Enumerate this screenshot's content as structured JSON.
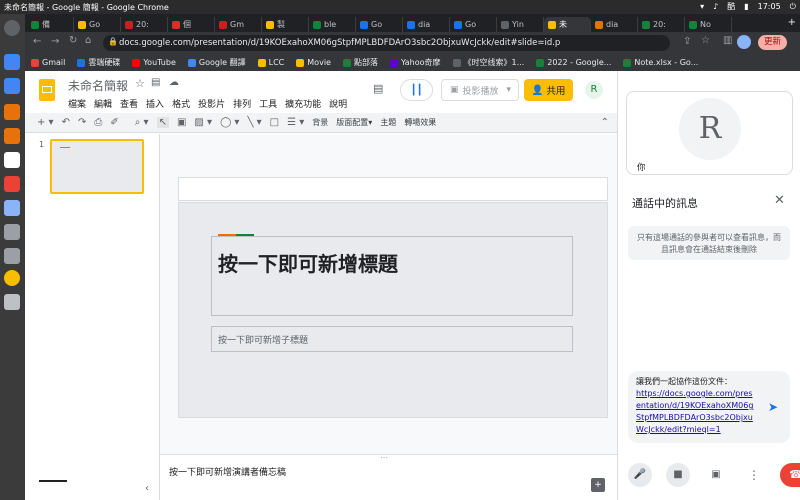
{
  "os": {
    "window_title": "未命名簡報 - Google 簡報 - Google Chrome",
    "clock": "17:05"
  },
  "tabs": [
    {
      "label": "備",
      "color": "#188038"
    },
    {
      "label": "Go",
      "color": "#fbbc04"
    },
    {
      "label": "20:",
      "color": "#c5221f"
    },
    {
      "label": "個",
      "color": "#d93025"
    },
    {
      "label": "Gm",
      "color": "#c5221f"
    },
    {
      "label": "製",
      "color": "#fbbc04"
    },
    {
      "label": "ble",
      "color": "#188038"
    },
    {
      "label": "Go",
      "color": "#1a73e8"
    },
    {
      "label": "dia",
      "color": "#1a73e8"
    },
    {
      "label": "Go",
      "color": "#1a73e8"
    },
    {
      "label": "Yin",
      "color": "#5f6368"
    },
    {
      "label": "未",
      "color": "#fbbc04"
    },
    {
      "label": "dia",
      "color": "#e37400"
    },
    {
      "label": "20:",
      "color": "#188038"
    },
    {
      "label": "No",
      "color": "#188038"
    }
  ],
  "browser": {
    "url": "docs.google.com/presentation/d/19KOExahoXM06gStpfMPLBDFDArO3sbc2ObjxuWcJckk/edit#slide=id.p",
    "update_label": "更新"
  },
  "bookmarks": [
    {
      "label": "Gmail",
      "color": "#ea4335"
    },
    {
      "label": "雲端硬碟",
      "color": "#1a73e8"
    },
    {
      "label": "YouTube",
      "color": "#ff0000"
    },
    {
      "label": "Google 翻譯",
      "color": "#4285f4"
    },
    {
      "label": "LCC",
      "color": "#fbbc04"
    },
    {
      "label": "Movie",
      "color": "#fbbc04"
    },
    {
      "label": "點部落",
      "color": "#188038"
    },
    {
      "label": "Yahoo奇摩",
      "color": "#6001d2"
    },
    {
      "label": "《时空线索》1...",
      "color": "#5f6368"
    },
    {
      "label": "2022 - Google...",
      "color": "#188038"
    },
    {
      "label": "Note.xlsx - Go...",
      "color": "#188038"
    }
  ],
  "doc": {
    "title": "未命名簡報",
    "menus": [
      "檔案",
      "編輯",
      "查看",
      "插入",
      "格式",
      "投影片",
      "排列",
      "工具",
      "擴充功能",
      "說明"
    ],
    "present_label": "投影播放",
    "share_label": "共用",
    "toolbar_labels": {
      "background": "背景",
      "layout": "版面配置",
      "theme": "主題",
      "transition": "轉場效果"
    }
  },
  "slide": {
    "number": "1",
    "title_placeholder": "按一下即可新增標題",
    "subtitle_placeholder": "按一下即可新增子標題",
    "notes_placeholder": "按一下即可新增演講者備忘稿"
  },
  "call": {
    "you_label": "你",
    "panel_title": "通話中的訊息",
    "info": "只有這場通話的參與者可以查看訊息，而且訊息會在通話結束後刪除",
    "message_intro": "讓我們一起協作這份文件：",
    "message_link": "https://docs.google.com/presentation/d/19KOExahoXM06gStpfMPLBDFDArO3sbc2ObjxuWcJckk/edit?mieql=1"
  },
  "colors": {
    "accent": "#1a73e8",
    "share": "#fbbc04",
    "end_call": "#ea4335",
    "slide_bar_orange": "#e8710a",
    "slide_bar_green": "#188038"
  }
}
